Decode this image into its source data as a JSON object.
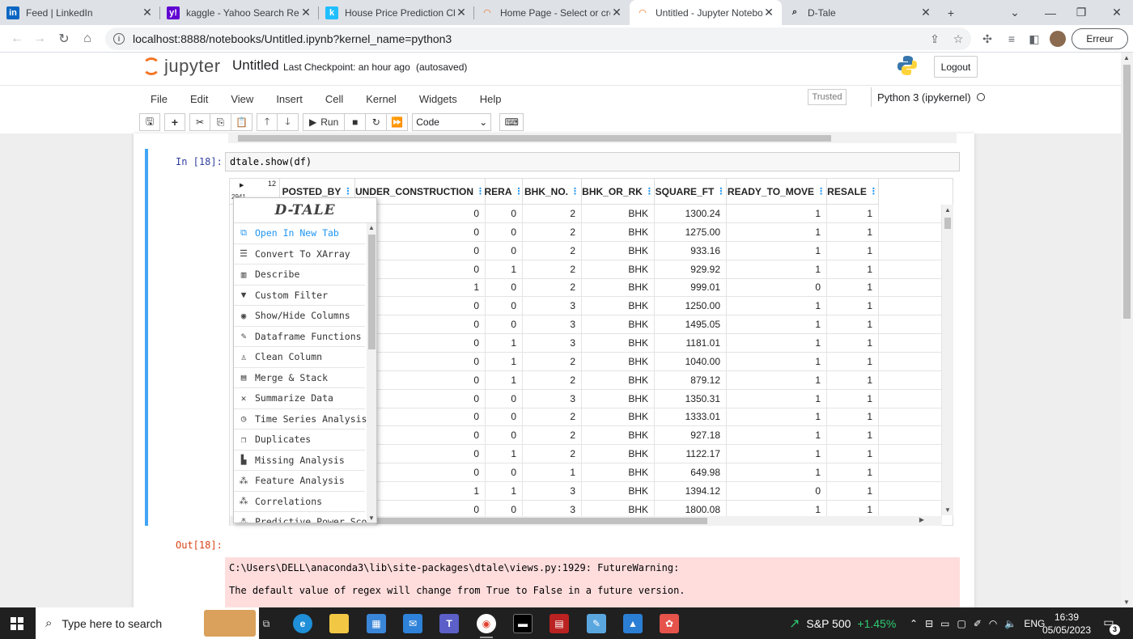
{
  "browser": {
    "tabs": [
      {
        "title": "Feed | LinkedIn",
        "icon": "linkedin-icon",
        "fav": "in",
        "color": "#0a66c2"
      },
      {
        "title": "kaggle - Yahoo Search Resu",
        "icon": "yahoo-icon",
        "fav": "y!",
        "color": "#6001d2"
      },
      {
        "title": "House Price Prediction Chal",
        "icon": "kaggle-icon",
        "fav": "k",
        "color": "#20beff"
      },
      {
        "title": "Home Page - Select or creat",
        "icon": "jupyter-icon",
        "fav": "◠",
        "color": "#f37626"
      },
      {
        "title": "Untitled - Jupyter Notebook",
        "icon": "jupyter-icon",
        "fav": "◠",
        "color": "#f37626",
        "active": true
      },
      {
        "title": "D-Tale",
        "icon": "search-icon",
        "fav": "⌕",
        "color": "#202124"
      }
    ],
    "new_tab": "+",
    "url": "localhost:8888/notebooks/Untitled.ipynb?kernel_name=python3",
    "profile_label": "Erreur"
  },
  "jupyter": {
    "logo_text": "jupyter",
    "notebook_name": "Untitled",
    "checkpoint": "Last Checkpoint: an hour ago",
    "autosave": "(autosaved)",
    "logout": "Logout",
    "menu": [
      "File",
      "Edit",
      "View",
      "Insert",
      "Cell",
      "Kernel",
      "Widgets",
      "Help"
    ],
    "trusted": "Trusted",
    "kernel": "Python 3 (ipykernel)",
    "run_label": "Run",
    "cell_type": "Code"
  },
  "cell": {
    "in_prompt": "In [18]:",
    "code": "dtale.show(df)",
    "out_prompt": "Out[18]:",
    "stderr": [
      "C:\\Users\\DELL\\anaconda3\\lib\\site-packages\\dtale\\views.py:1929: FutureWarning:",
      "The default value of regex will change from True to False in a future version."
    ]
  },
  "dtale": {
    "col_count": "12",
    "row_count": "2941",
    "columns": [
      "POSTED_BY",
      "UNDER_CONSTRUCTION",
      "RERA",
      "BHK_NO.",
      "BHK_OR_RK",
      "SQUARE_FT",
      "READY_TO_MOVE",
      "RESALE"
    ],
    "rows": [
      [
        "",
        "0",
        "0",
        "2",
        "BHK",
        "1300.24",
        "1",
        "1"
      ],
      [
        "",
        "0",
        "0",
        "2",
        "BHK",
        "1275.00",
        "1",
        "1"
      ],
      [
        "",
        "0",
        "0",
        "2",
        "BHK",
        "933.16",
        "1",
        "1"
      ],
      [
        "",
        "0",
        "1",
        "2",
        "BHK",
        "929.92",
        "1",
        "1"
      ],
      [
        "",
        "1",
        "0",
        "2",
        "BHK",
        "999.01",
        "0",
        "1"
      ],
      [
        "",
        "0",
        "0",
        "3",
        "BHK",
        "1250.00",
        "1",
        "1"
      ],
      [
        "",
        "0",
        "0",
        "3",
        "BHK",
        "1495.05",
        "1",
        "1"
      ],
      [
        "",
        "0",
        "1",
        "3",
        "BHK",
        "1181.01",
        "1",
        "1"
      ],
      [
        "",
        "0",
        "1",
        "2",
        "BHK",
        "1040.00",
        "1",
        "1"
      ],
      [
        "",
        "0",
        "1",
        "2",
        "BHK",
        "879.12",
        "1",
        "1"
      ],
      [
        "",
        "0",
        "0",
        "3",
        "BHK",
        "1350.31",
        "1",
        "1"
      ],
      [
        "",
        "0",
        "0",
        "2",
        "BHK",
        "1333.01",
        "1",
        "1"
      ],
      [
        "",
        "0",
        "0",
        "2",
        "BHK",
        "927.18",
        "1",
        "1"
      ],
      [
        "",
        "0",
        "1",
        "2",
        "BHK",
        "1122.17",
        "1",
        "1"
      ],
      [
        "",
        "0",
        "0",
        "1",
        "BHK",
        "649.98",
        "1",
        "1"
      ],
      [
        "",
        "1",
        "1",
        "3",
        "BHK",
        "1394.12",
        "0",
        "1"
      ],
      [
        "",
        "0",
        "0",
        "3",
        "BHK",
        "1800.08",
        "1",
        "1"
      ]
    ],
    "menu_brand": "D-TALE",
    "menu": [
      {
        "label": "Open In New Tab",
        "icon": "external-link-icon",
        "glyph": "⧉"
      },
      {
        "label": "Convert To XArray",
        "icon": "sliders-icon",
        "glyph": "☰"
      },
      {
        "label": "Describe",
        "icon": "bars-icon",
        "glyph": "▥"
      },
      {
        "label": "Custom Filter",
        "icon": "filter-icon",
        "glyph": "▼"
      },
      {
        "label": "Show/Hide Columns",
        "icon": "eye-icon",
        "glyph": "◉"
      },
      {
        "label": "Dataframe Functions",
        "icon": "wrench-icon",
        "glyph": "✎"
      },
      {
        "label": "Clean Column",
        "icon": "spray-icon",
        "glyph": "♙"
      },
      {
        "label": "Merge & Stack",
        "icon": "merge-icon",
        "glyph": "▤"
      },
      {
        "label": "Summarize Data",
        "icon": "tools-icon",
        "glyph": "✕"
      },
      {
        "label": "Time Series Analysis",
        "icon": "clock-icon",
        "glyph": "◷"
      },
      {
        "label": "Duplicates",
        "icon": "copy-icon",
        "glyph": "❐"
      },
      {
        "label": "Missing Analysis",
        "icon": "chart-icon",
        "glyph": "▙"
      },
      {
        "label": "Feature Analysis",
        "icon": "scatter-icon",
        "glyph": "⁂"
      },
      {
        "label": "Correlations",
        "icon": "scatter-icon",
        "glyph": "⁂"
      },
      {
        "label": "Predictive Power Score",
        "icon": "scatter-icon",
        "glyph": "⁂"
      }
    ]
  },
  "taskbar": {
    "search_placeholder": "Type here to search",
    "ticker": "S&P 500",
    "ticker_change": "+1.45%",
    "lang": "ENG",
    "time": "16:39",
    "date": "05/05/2023",
    "notifications": "3"
  }
}
